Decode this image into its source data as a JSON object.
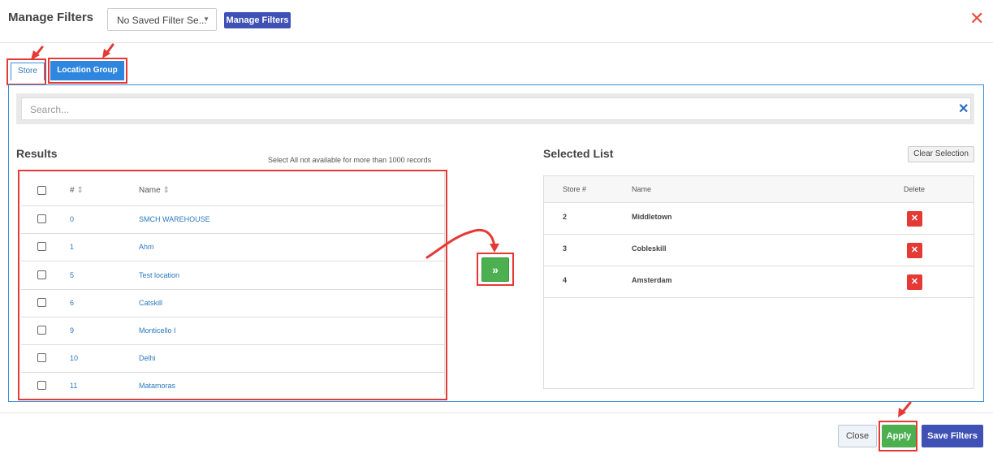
{
  "header": {
    "title": "Manage Filters",
    "saved_filter_select": "No Saved Filter Se...",
    "manage_filters_button": "Manage Filters"
  },
  "tabs": [
    {
      "label": "Store",
      "active": true
    },
    {
      "label": "Location Group",
      "active": false
    }
  ],
  "search": {
    "placeholder": "Search..."
  },
  "results": {
    "title": "Results",
    "note": "Select All not available for more than 1000 records",
    "columns": [
      "#",
      "Name"
    ],
    "rows": [
      {
        "num": "0",
        "name": "SMCH WAREHOUSE"
      },
      {
        "num": "1",
        "name": "Ahm"
      },
      {
        "num": "5",
        "name": "Test location"
      },
      {
        "num": "6",
        "name": "Catskill"
      },
      {
        "num": "9",
        "name": "Monticello I"
      },
      {
        "num": "10",
        "name": "Delhi"
      },
      {
        "num": "11",
        "name": "Matamoras"
      }
    ]
  },
  "move_button": "»",
  "selected": {
    "title": "Selected List",
    "clear_button": "Clear Selection",
    "columns": [
      "Store #",
      "Name",
      "Delete"
    ],
    "rows": [
      {
        "store": "2",
        "name": "Middletown"
      },
      {
        "store": "3",
        "name": "Cobleskill"
      },
      {
        "store": "4",
        "name": "Amsterdam"
      }
    ]
  },
  "footer": {
    "close": "Close",
    "apply": "Apply",
    "save_filters": "Save Filters"
  },
  "colors": {
    "primary": "#3f51b5",
    "tab_blue": "#2e86de",
    "success": "#4caf50",
    "danger": "#e53935",
    "annotation": "#e53935"
  }
}
